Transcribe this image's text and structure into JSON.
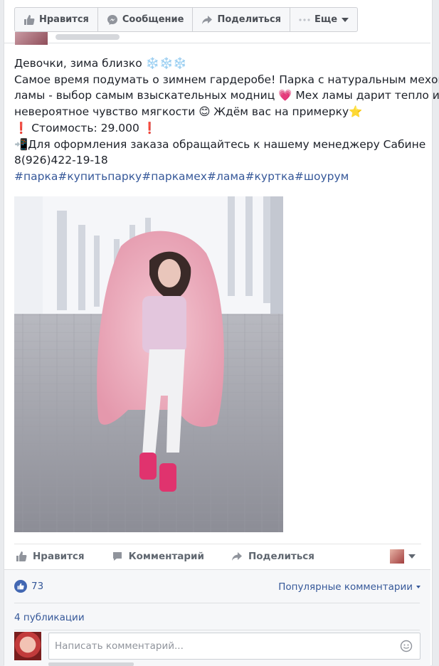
{
  "page_actions": {
    "like": "Нравится",
    "message": "Сообщение",
    "share": "Поделиться",
    "more": "Еще"
  },
  "post": {
    "lines": [
      "Девочки, зима близко ❄️❄️❄️",
      "Самое время подумать о зимнем гардеробе! Парка с натуральным мехом",
      "ламы - выбор самым взыскательных модниц 💗 Мех ламы дарит тепло и",
      "невероятное чувство мягкости 😊 Ждём вас на примерку⭐",
      "❗ Стоимость: 29.000 ❗",
      "📲Для оформления заказа обращайтесь к нашему менеджеру Сабине",
      "8(926)422-19-18"
    ],
    "hashtags": [
      "#парка",
      "#купитьпарку",
      "#паркамех",
      "#лама",
      "#куртка",
      "#шоурум"
    ]
  },
  "actions": {
    "like": "Нравится",
    "comment": "Комментарий",
    "share": "Поделиться"
  },
  "stats": {
    "likes_count": "73",
    "popular_label": "Популярные комментарии",
    "publications": "4 публикации"
  },
  "comment_input": {
    "placeholder": "Написать комментарий..."
  },
  "colors": {
    "link": "#365899",
    "like_blue": "#4267b2",
    "background": "#e9ebee"
  },
  "icons": [
    "thumb-up-icon",
    "messenger-icon",
    "share-arrow-icon",
    "dots-icon",
    "chevron-down-icon",
    "comment-icon",
    "smile-icon"
  ]
}
